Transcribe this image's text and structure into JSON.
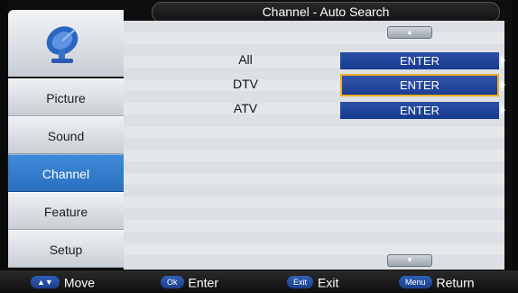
{
  "window": {
    "title": "Channel - Auto Search"
  },
  "sidebar": {
    "logo_icon": "satellite-dish-icon",
    "items": [
      {
        "label": "Picture",
        "active": false
      },
      {
        "label": "Sound",
        "active": false
      },
      {
        "label": "Channel",
        "active": true
      },
      {
        "label": "Feature",
        "active": false
      },
      {
        "label": "Setup",
        "active": false
      }
    ]
  },
  "main": {
    "scroll_up_icon": "triangle-up-icon",
    "scroll_down_icon": "triangle-down-icon",
    "rows": [
      {
        "label": "All",
        "button": "ENTER",
        "selected": false
      },
      {
        "label": "DTV",
        "button": "ENTER",
        "selected": true
      },
      {
        "label": "ATV",
        "button": "ENTER",
        "selected": false
      }
    ]
  },
  "footer": {
    "move": {
      "key": "▲▼",
      "label": "Move"
    },
    "enter": {
      "key": "Ok",
      "label": "Enter"
    },
    "exit": {
      "key": "Exit",
      "label": "Exit"
    },
    "return": {
      "key": "Menu",
      "label": "Return"
    }
  },
  "colors": {
    "accent_blue": "#2a6fc0",
    "button_blue": "#163a8c",
    "selection_border": "#f0b020"
  }
}
